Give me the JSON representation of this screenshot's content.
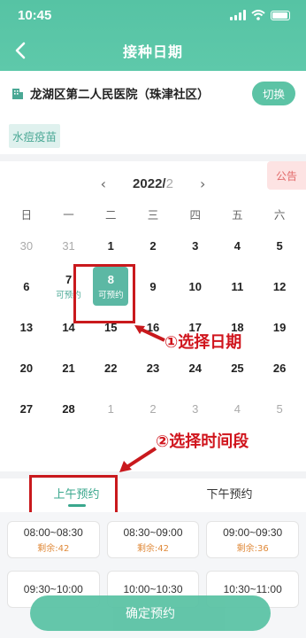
{
  "status": {
    "time": "10:45"
  },
  "nav": {
    "title": "接种日期"
  },
  "hospital": {
    "name": "龙湖区第二人民医院（珠津社区）",
    "switch_label": "切换"
  },
  "vaccine": {
    "tag": "水痘疫苗"
  },
  "calendar": {
    "year_label": "2022/",
    "month_label": "2",
    "notice_label": "公告",
    "weekdays": [
      "日",
      "一",
      "二",
      "三",
      "四",
      "五",
      "六"
    ],
    "days": [
      {
        "n": "30",
        "other": true
      },
      {
        "n": "31",
        "other": true
      },
      {
        "n": "1"
      },
      {
        "n": "2"
      },
      {
        "n": "3"
      },
      {
        "n": "4"
      },
      {
        "n": "5"
      },
      {
        "n": "6"
      },
      {
        "n": "7",
        "avail": "可预约"
      },
      {
        "n": "8",
        "avail": "可预约",
        "selected": true
      },
      {
        "n": "9"
      },
      {
        "n": "10"
      },
      {
        "n": "11"
      },
      {
        "n": "12"
      },
      {
        "n": "13"
      },
      {
        "n": "14"
      },
      {
        "n": "15"
      },
      {
        "n": "16"
      },
      {
        "n": "17"
      },
      {
        "n": "18"
      },
      {
        "n": "19"
      },
      {
        "n": "20"
      },
      {
        "n": "21"
      },
      {
        "n": "22"
      },
      {
        "n": "23"
      },
      {
        "n": "24"
      },
      {
        "n": "25"
      },
      {
        "n": "26"
      },
      {
        "n": "27"
      },
      {
        "n": "28"
      },
      {
        "n": "1",
        "other": true
      },
      {
        "n": "2",
        "other": true
      },
      {
        "n": "3",
        "other": true
      },
      {
        "n": "4",
        "other": true
      },
      {
        "n": "5",
        "other": true
      }
    ]
  },
  "annotations": {
    "step1": "①选择日期",
    "step2": "②选择时间段"
  },
  "tabs": [
    {
      "label": "上午预约",
      "active": true
    },
    {
      "label": "下午预约",
      "active": false
    }
  ],
  "slots": [
    {
      "time": "08:00~08:30",
      "left": "剩余:42"
    },
    {
      "time": "08:30~09:00",
      "left": "剩余:42"
    },
    {
      "time": "09:00~09:30",
      "left": "剩余:36"
    },
    {
      "time": "09:30~10:00",
      "left": ""
    },
    {
      "time": "10:00~10:30",
      "left": ""
    },
    {
      "time": "10:30~11:00",
      "left": ""
    }
  ],
  "footer": {
    "confirm_label": "确定预约"
  },
  "colors": {
    "accent": "#5cc3a5",
    "annotation": "#c9191d"
  }
}
